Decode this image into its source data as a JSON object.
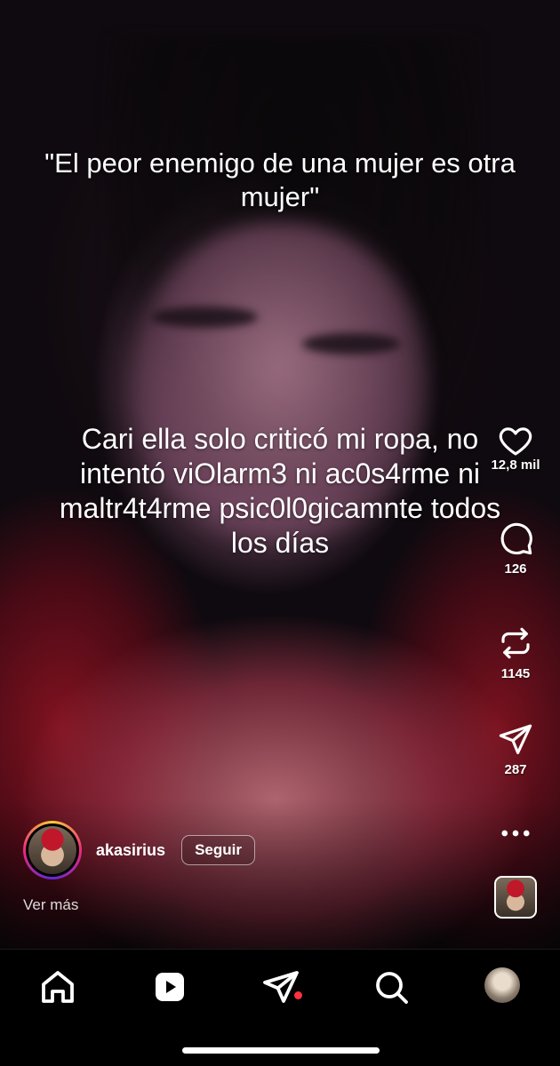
{
  "captions": {
    "top": "\"El peor enemigo de una mujer es otra mujer\"",
    "middle": "Cari ella solo criticó mi ropa, no intentó viOlarm3 ni ac0s4rme ni maltr4t4rme psic0l0gicamnte todos los días"
  },
  "actions": {
    "likes": "12,8 mil",
    "comments": "126",
    "reposts": "1145",
    "shares": "287"
  },
  "author": {
    "username": "akasirius",
    "follow_label": "Seguir",
    "more_label": "Ver más"
  },
  "icons": {
    "like": "heart-icon",
    "comment": "comment-bubble-icon",
    "repost": "repost-icon",
    "share": "paper-plane-icon",
    "more": "more-dots-icon",
    "nav": [
      "home-icon",
      "reels-icon",
      "direct-message-icon",
      "search-icon",
      "profile-avatar"
    ]
  },
  "colors": {
    "notification_dot": "#ff3040",
    "story_ring": [
      "#f9ce34",
      "#ee2a7b",
      "#6228d7"
    ]
  }
}
